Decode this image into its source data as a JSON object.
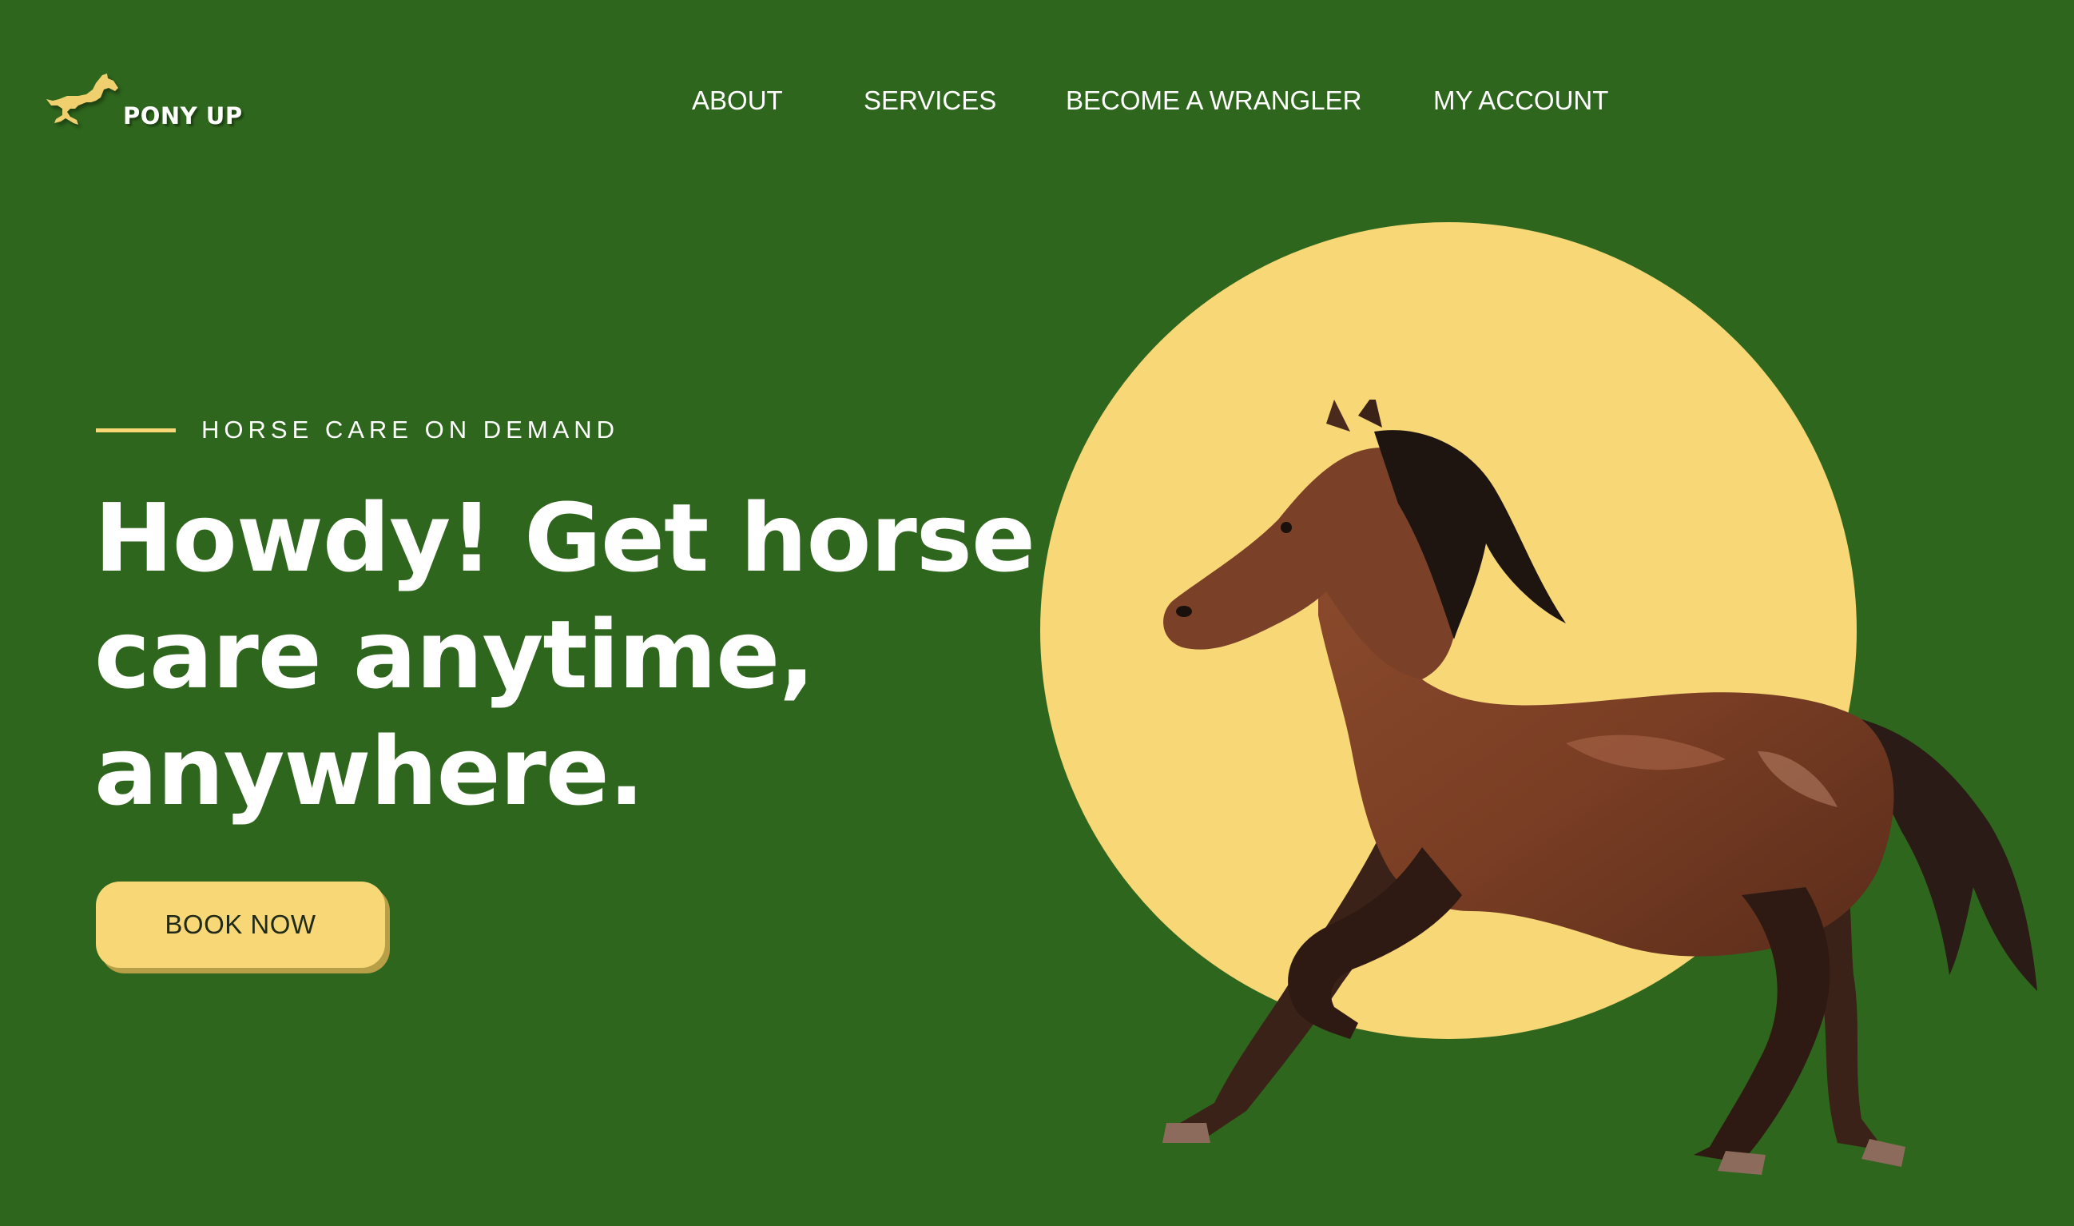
{
  "brand": {
    "name": "PONY UP",
    "logo_icon": "horse-icon",
    "accent": "#f8d777",
    "background": "#2e661d"
  },
  "nav": {
    "about": "ABOUT",
    "services": "SERVICES",
    "wrangler": "BECOME A WRANGLER",
    "account": "MY ACCOUNT"
  },
  "hero": {
    "eyebrow": "HORSE CARE ON DEMAND",
    "headline_lines": [
      "Howdy! Get horse",
      "care anytime,",
      "anywhere."
    ],
    "cta": "BOOK NOW"
  }
}
